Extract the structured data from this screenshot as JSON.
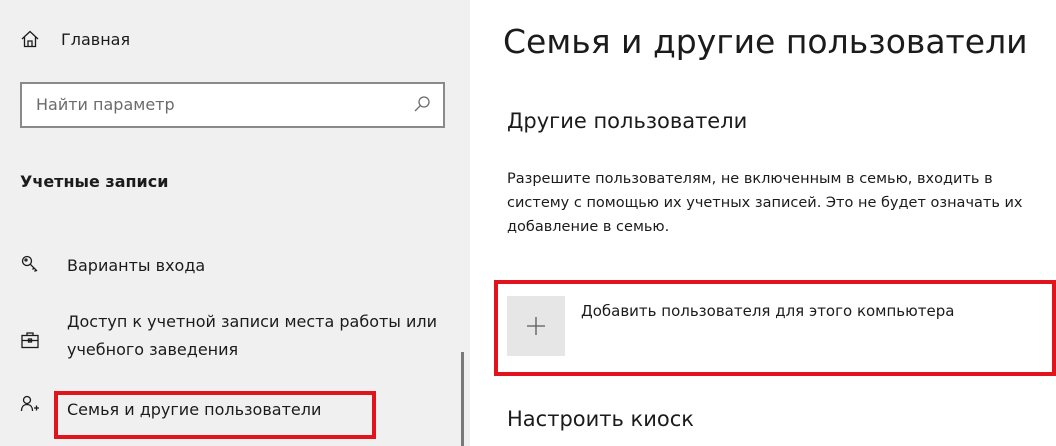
{
  "sidebar": {
    "home_label": "Главная",
    "search_placeholder": "Найти параметр",
    "section_title": "Учетные записи",
    "items": [
      {
        "icon": "key-icon",
        "label": "Варианты входа"
      },
      {
        "icon": "briefcase-icon",
        "label": "Доступ к учетной записи места работы или учебного заведения"
      },
      {
        "icon": "person-add-icon",
        "label": "Семья и другие пользователи"
      }
    ]
  },
  "main": {
    "title": "Семья и другие пользователи",
    "other_users_heading": "Другие пользователи",
    "other_users_description": "Разрешите пользователям, не включенным в семью, входить в систему с помощью их учетных записей. Это не будет означать их добавление в семью.",
    "add_user_label": "Добавить пользователя для этого компьютера",
    "kiosk_heading": "Настроить киоск"
  },
  "colors": {
    "sidebar_bg": "#f0f0f0",
    "highlight": "#e2141b",
    "add_box_bg": "#e6e6e6"
  }
}
